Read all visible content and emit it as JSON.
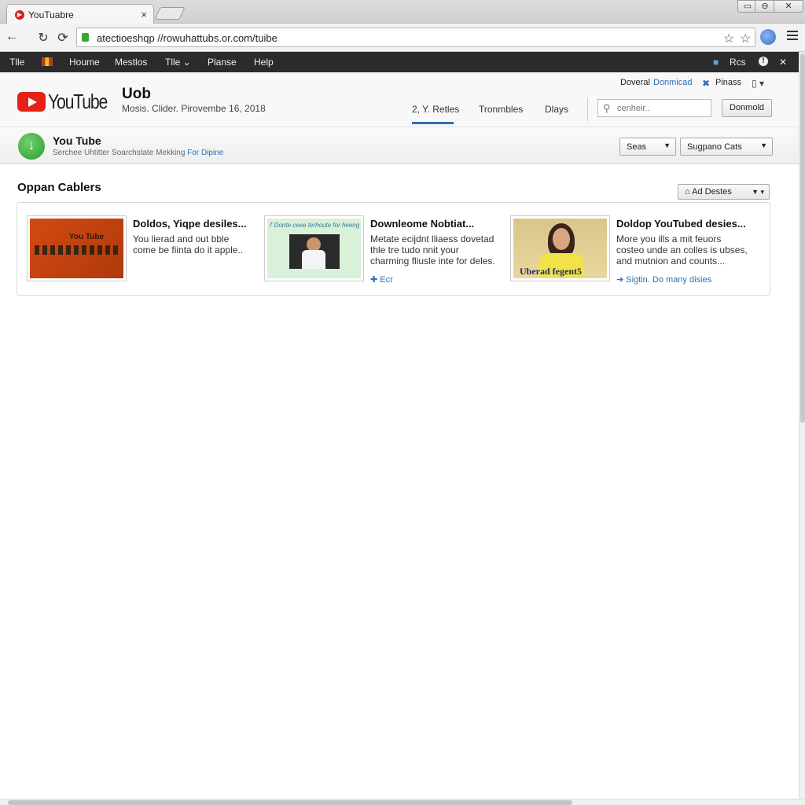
{
  "browser": {
    "tab_title": "YouTuabre",
    "tab_close": "×",
    "url": "atectioeshqp //rowuhattubs.or.com/tuibe",
    "window_buttons": [
      "▭",
      "⊖",
      "✕"
    ]
  },
  "menubar": {
    "items": [
      "Tlle",
      "Houme",
      "Mestlos",
      "Tlle ⌄",
      "Planse",
      "Help"
    ],
    "right_label": "Rcs",
    "info_icon": "!",
    "close_icon": "✕"
  },
  "header": {
    "logo_text": "YouTube",
    "title": "Uob",
    "subtitle": "Mosis. Clider. Pirovembe 16, 2018",
    "tabs": [
      {
        "label": "2, Y. Retles",
        "active": true
      },
      {
        "label": "Tronmbles",
        "active": false
      },
      {
        "label": "Dlays",
        "active": false
      }
    ],
    "search_placeholder": "cenheir..",
    "download_button": "Donmold",
    "top_links": {
      "doveral": "Doveral",
      "download": "Donmicad",
      "pinass": "Pinass"
    }
  },
  "appbar": {
    "name": "You Tube",
    "desc_prefix": "Serchee Uhtitter Soarchstate Mekking",
    "desc_link": "For Dipine",
    "select1": "Seas",
    "select2": "Sugpano Cats",
    "caret": "▼"
  },
  "content": {
    "section_title": "Oppan Cablers",
    "add_button": "Ad Destes",
    "items": [
      {
        "title": "Doldos, Yiqpe desiles...",
        "desc": "You lierad and out bble come be fiinta do it apple..",
        "link": "",
        "thumb_text": "You Tube"
      },
      {
        "title": "Downleome Nobtiat...",
        "desc": "Metate ecijdnt lliaess dovetad thle tre tudo nnit your charming fliusle inte for deles.",
        "link": "Ecr",
        "thumb_text": "7 Donte ceee terhoute for heeng"
      },
      {
        "title": "Doldop YouTubed desies...",
        "desc": "More you ills a mit feuors costeo unde an colles is ubses, and mutnion and counts...",
        "link": "Sigtin. Do many disies",
        "thumb_text": "Uberad fegent5"
      }
    ]
  },
  "colors": {
    "accent": "#2f6fb5",
    "youtube_red": "#e62117",
    "menubar_bg": "#2b2b2b",
    "app_green": "#2e9a2e"
  }
}
